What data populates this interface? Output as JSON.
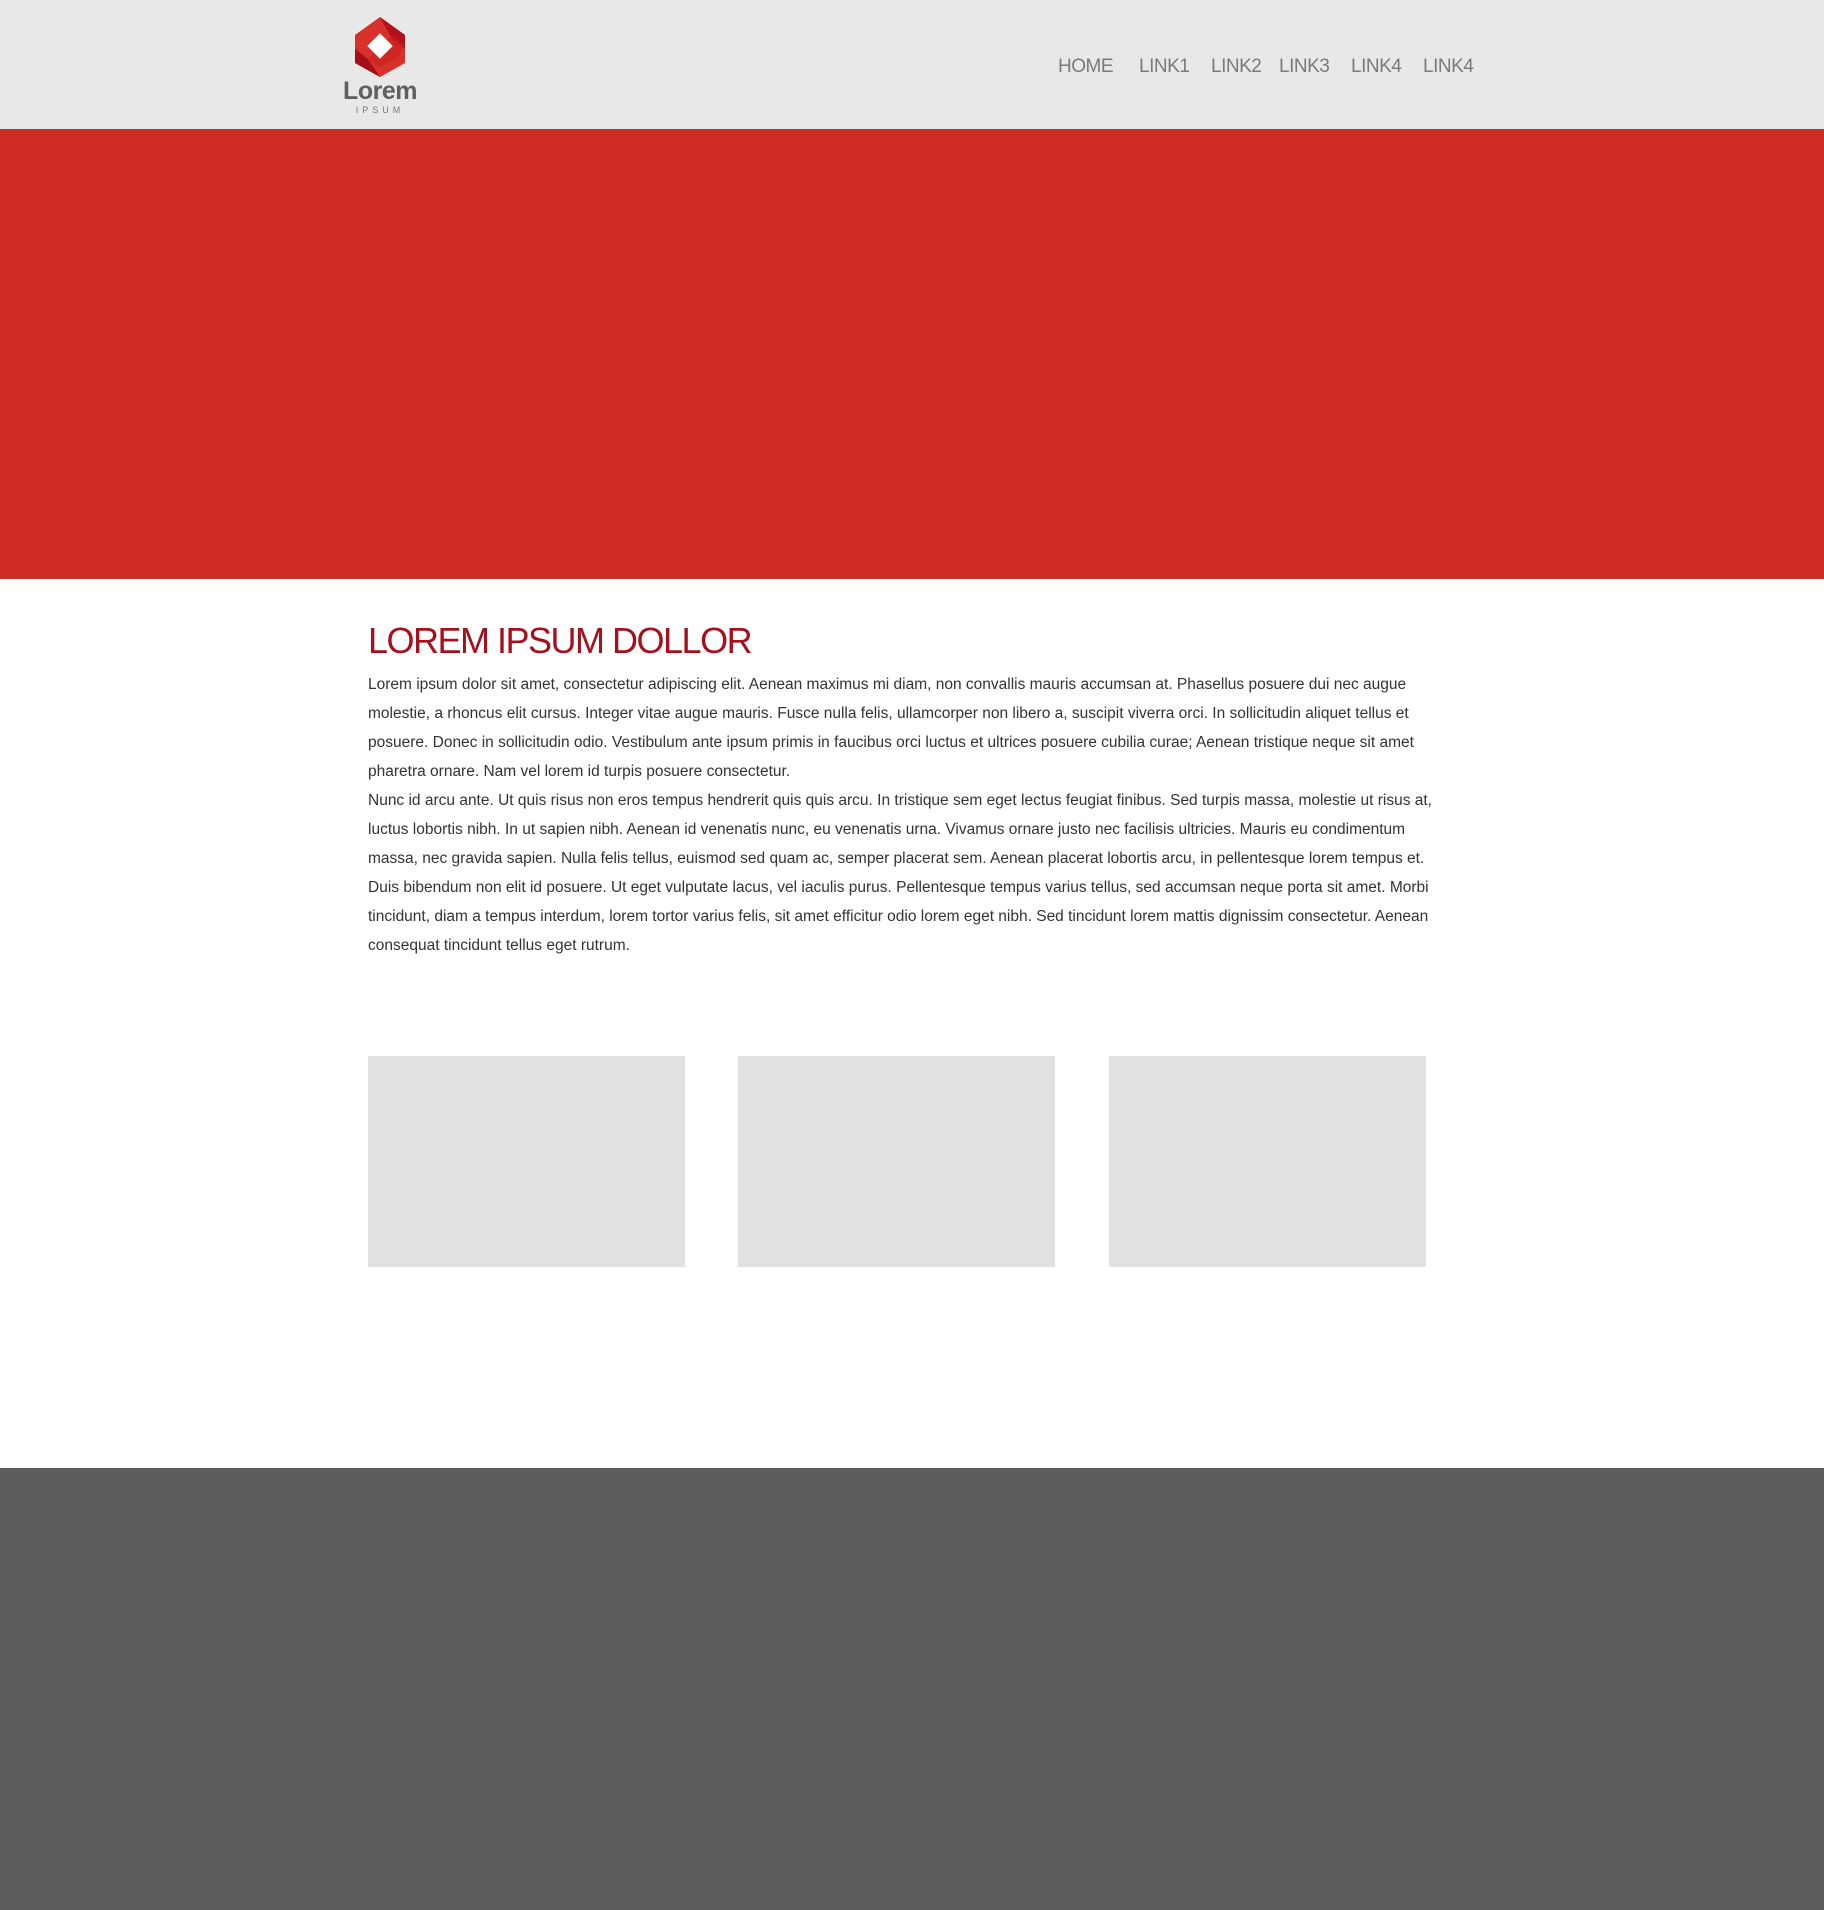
{
  "header": {
    "logo": {
      "text": "Lorem",
      "subtext": "IPSUM"
    },
    "nav": [
      {
        "label": "HOME"
      },
      {
        "label": "LINK1"
      },
      {
        "label": "LINK2"
      },
      {
        "label": "LINK3"
      },
      {
        "label": "LINK4"
      },
      {
        "label": "LINK4"
      }
    ]
  },
  "colors": {
    "header_bg": "#e8e8e8",
    "hero": "#cf2c26",
    "heading": "#a5101c",
    "card": "#e1e1e1",
    "footer": "#5c5c5c"
  },
  "main": {
    "title": "LOREM IPSUM DOLLOR",
    "paragraphs": [
      "Lorem ipsum dolor sit amet, consectetur adipiscing elit. Aenean maximus mi diam, non convallis mauris accumsan at. Phasellus posuere dui nec augue molestie, a rhoncus elit cursus. Integer vitae augue mauris. Fusce nulla felis, ullamcorper non libero a, suscipit viverra orci. In sollicitudin aliquet tellus et posuere. Donec in sollicitudin odio. Vestibulum ante ipsum primis in faucibus orci luctus et ultrices posuere cubilia curae; Aenean tristique neque sit amet pharetra ornare. Nam vel lorem id turpis posuere consectetur.",
      "Nunc id arcu ante. Ut quis risus non eros tempus hendrerit quis quis arcu. In tristique sem eget lectus feugiat finibus. Sed turpis massa, molestie ut risus at, luctus lobortis nibh. In ut sapien nibh. Aenean id venenatis nunc, eu venenatis urna. Vivamus ornare justo nec facilisis ultricies. Mauris eu condimentum massa, nec gravida sapien. Nulla felis tellus, euismod sed quam ac, semper placerat sem. Aenean placerat lobortis arcu, in pellentesque lorem tempus et. Duis bibendum non elit id posuere. Ut eget vulputate lacus, vel iaculis purus. Pellentesque tempus varius tellus, sed accumsan neque porta sit amet. Morbi tincidunt, diam a tempus interdum, lorem tortor varius felis, sit amet efficitur odio lorem eget nibh. Sed tincidunt lorem mattis dignissim consectetur. Aenean consequat tincidunt tellus eget rutrum."
    ]
  }
}
